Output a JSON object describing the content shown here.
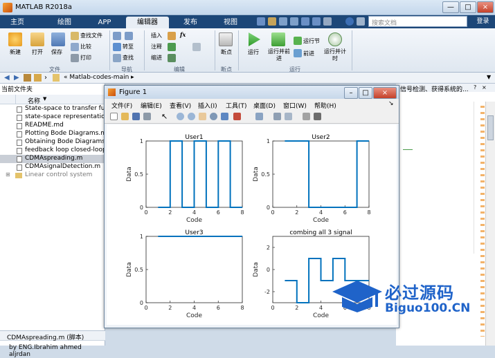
{
  "window": {
    "title": "MATLAB R2018a",
    "controls": [
      "—",
      "□",
      "×"
    ]
  },
  "ribbon_tabs": [
    "主页",
    "绘图",
    "APP",
    "编辑器",
    "发布",
    "视图"
  ],
  "active_tab": "编辑器",
  "search": {
    "placeholder": "搜索文档"
  },
  "login_label": "登录",
  "ribbon": {
    "file": {
      "group": "文件",
      "new": "新建",
      "open": "打开",
      "save": "保存",
      "find_files": "查找文件",
      "compare": "比较",
      "print": "打印"
    },
    "navigate": {
      "group": "导航",
      "goto": "转至",
      "find": "查找"
    },
    "edit": {
      "group": "编辑",
      "insert": "插入",
      "comment": "注释",
      "indent": "缩进",
      "fx": "fx"
    },
    "breakpoints": {
      "group": "断点",
      "label": "断点"
    },
    "run": {
      "group": "运行",
      "run": "运行",
      "run_advance": "运行并前进",
      "run_section": "运行节",
      "advance": "前进",
      "run_time": "运行并计时"
    }
  },
  "address": {
    "path": "Matlab-codes-main"
  },
  "current_folder": {
    "title": "当前文件夹",
    "col_name": "名称",
    "files": [
      "State-space to transfer fun",
      "state-space representation",
      "README.md",
      "Plotting Bode Diagrams.m",
      "Obtaining Bode Diagrams",
      "feedback loop closed-loop",
      "CDMAspreading.m",
      "CDMAsignalDetection.m",
      "Linear control system"
    ],
    "selected_index": 6
  },
  "details": {
    "title": "CDMAspreading.m (脚本)",
    "author_line": "by ENG.Ibrahim ahmed aljrdan"
  },
  "right_panel": {
    "text": "信号检测、获得系统的..."
  },
  "figure": {
    "title": "Figure 1",
    "menus": [
      "文件(F)",
      "编辑(E)",
      "查看(V)",
      "插入(I)",
      "工具(T)",
      "桌面(D)",
      "窗口(W)",
      "帮助(H)"
    ]
  },
  "chart_data": [
    {
      "type": "line",
      "title": "User1",
      "xlabel": "Code",
      "ylabel": "Data",
      "xlim": [
        0,
        8
      ],
      "ylim": [
        0,
        1
      ],
      "xticks": [
        0,
        2,
        4,
        6,
        8
      ],
      "yticks": [
        0,
        0.5,
        1
      ],
      "x": [
        1,
        2,
        2,
        3,
        3,
        4,
        4,
        5,
        5,
        6,
        6,
        7,
        7,
        8
      ],
      "y": [
        0,
        0,
        1,
        1,
        0,
        0,
        1,
        1,
        0,
        0,
        1,
        1,
        0,
        0
      ],
      "color": "#0072bd"
    },
    {
      "type": "line",
      "title": "User2",
      "xlabel": "Code",
      "ylabel": "Data",
      "xlim": [
        0,
        8
      ],
      "ylim": [
        0,
        1
      ],
      "xticks": [
        0,
        2,
        4,
        6,
        8
      ],
      "yticks": [
        0,
        0.5,
        1
      ],
      "x": [
        1,
        3,
        3,
        7,
        7,
        8
      ],
      "y": [
        1,
        1,
        0,
        0,
        1,
        1
      ],
      "color": "#0072bd"
    },
    {
      "type": "line",
      "title": "User3",
      "xlabel": "Code",
      "ylabel": "Data",
      "xlim": [
        0,
        8
      ],
      "ylim": [
        0,
        1
      ],
      "xticks": [
        0,
        2,
        4,
        6,
        8
      ],
      "yticks": [
        0,
        0.5,
        1
      ],
      "x": [
        1,
        8
      ],
      "y": [
        1,
        1
      ],
      "color": "#0072bd"
    },
    {
      "type": "line",
      "title": "combing all 3 signal",
      "xlabel": "Code",
      "ylabel": "Data",
      "xlim": [
        0,
        8
      ],
      "ylim": [
        -3,
        3
      ],
      "xticks": [
        0,
        2,
        4,
        6,
        8
      ],
      "yticks": [
        -2,
        0,
        2
      ],
      "x": [
        1,
        2,
        2,
        3,
        3,
        4,
        4,
        5,
        5,
        6,
        6,
        8
      ],
      "y": [
        -1,
        -1,
        -3,
        -3,
        1,
        1,
        -1,
        -1,
        1,
        1,
        -1,
        -1
      ],
      "color": "#0072bd"
    }
  ],
  "watermark": {
    "cn": "必过源码",
    "en": "Biguo100.CN"
  }
}
